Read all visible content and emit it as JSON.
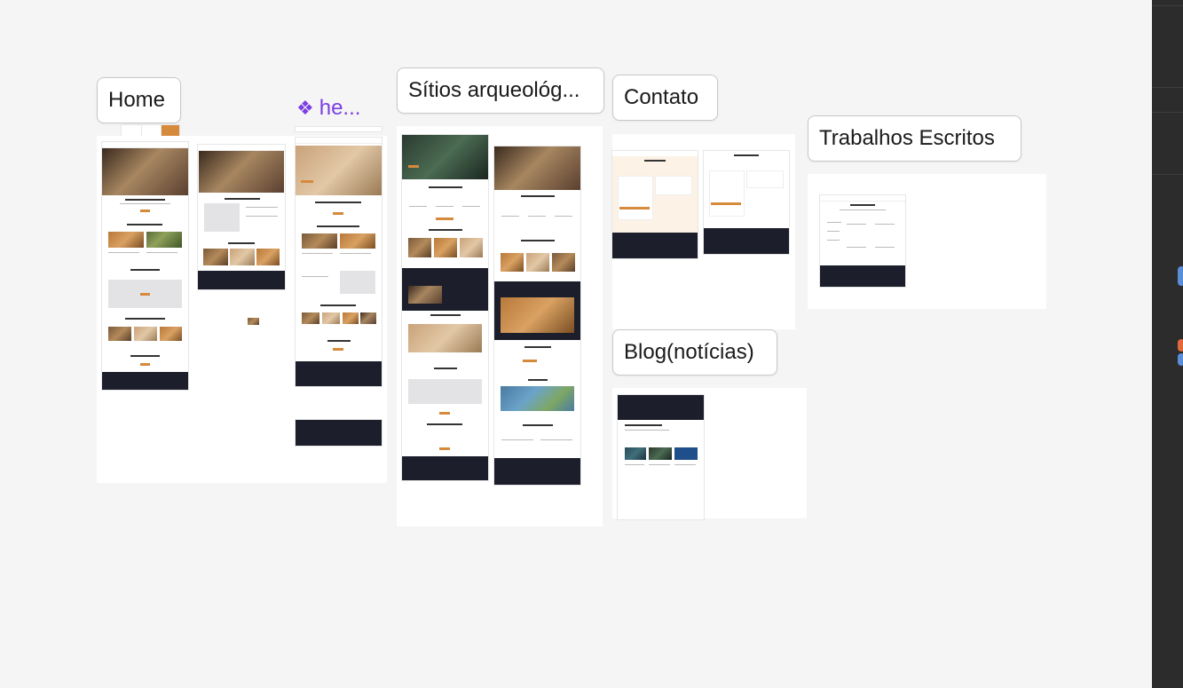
{
  "frames": {
    "home": {
      "label": "Home"
    },
    "component": {
      "label": "he..."
    },
    "sitios": {
      "label": "Sítios arqueológ..."
    },
    "contato": {
      "label": "Contato"
    },
    "blog": {
      "label": "Blog(notícias)"
    },
    "trabalhos": {
      "label": "Trabalhos Escritos"
    }
  },
  "icons": {
    "component": "component-icon"
  },
  "colors": {
    "canvas": "#f5f5f5",
    "component_purple": "#7b3fe4",
    "accent_orange": "#d68a3c",
    "footer_dark": "#1c1f2b",
    "sidebar_dark": "#2c2c2c"
  }
}
